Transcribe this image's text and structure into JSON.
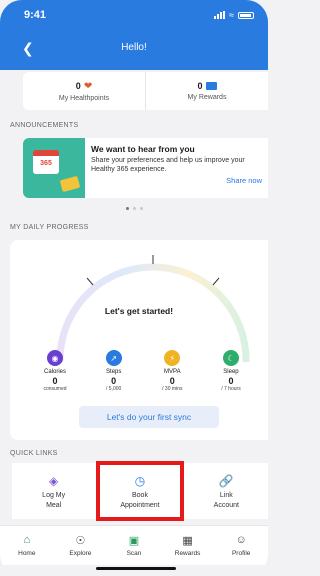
{
  "status": {
    "time": "9:41"
  },
  "header": {
    "title": "Hello!"
  },
  "points": [
    {
      "value": "0",
      "label": "My Healthpoints",
      "icon": "heart-icon",
      "color": "#e05a2d"
    },
    {
      "value": "0",
      "label": "My Rewards",
      "icon": "gift-icon",
      "color": "#2a7be0"
    }
  ],
  "announcements": {
    "section_label": "ANNOUNCEMENTS",
    "calendar_text": "365",
    "title": "We want to hear from you",
    "body": "Share your preferences and help us improve your Healthy 365 experience.",
    "cta": "Share now"
  },
  "progress": {
    "section_label": "MY DAILY PROGRESS",
    "status_text": "Let's get started!",
    "stats": [
      {
        "label": "Calories",
        "value": "0",
        "sub": "consumed",
        "color": "#6a3fcf",
        "icon": "food-icon"
      },
      {
        "label": "Steps",
        "value": "0",
        "sub": "/ 5,000",
        "color": "#2a7be0",
        "icon": "steps-icon"
      },
      {
        "label": "MVPA",
        "value": "0",
        "sub": "/ 30 mins",
        "color": "#f0b323",
        "icon": "bolt-icon"
      },
      {
        "label": "Sleep",
        "value": "0",
        "sub": "/ 7 hours",
        "color": "#2fae6b",
        "icon": "moon-icon"
      }
    ],
    "sync_button": "Let's do your first sync"
  },
  "quick_links": {
    "section_label": "QUICK LINKS",
    "items": [
      {
        "label1": "Log My",
        "label2": "Meal",
        "icon": "meal-icon"
      },
      {
        "label1": "Book",
        "label2": "Appointment",
        "icon": "appointment-icon"
      },
      {
        "label1": "Link",
        "label2": "Account",
        "icon": "link-icon"
      }
    ]
  },
  "tabbar": [
    {
      "label": "Home",
      "icon": "home-icon"
    },
    {
      "label": "Explore",
      "icon": "compass-icon"
    },
    {
      "label": "Scan",
      "icon": "scan-icon"
    },
    {
      "label": "Rewards",
      "icon": "rewards-icon"
    },
    {
      "label": "Profile",
      "icon": "profile-icon"
    }
  ]
}
